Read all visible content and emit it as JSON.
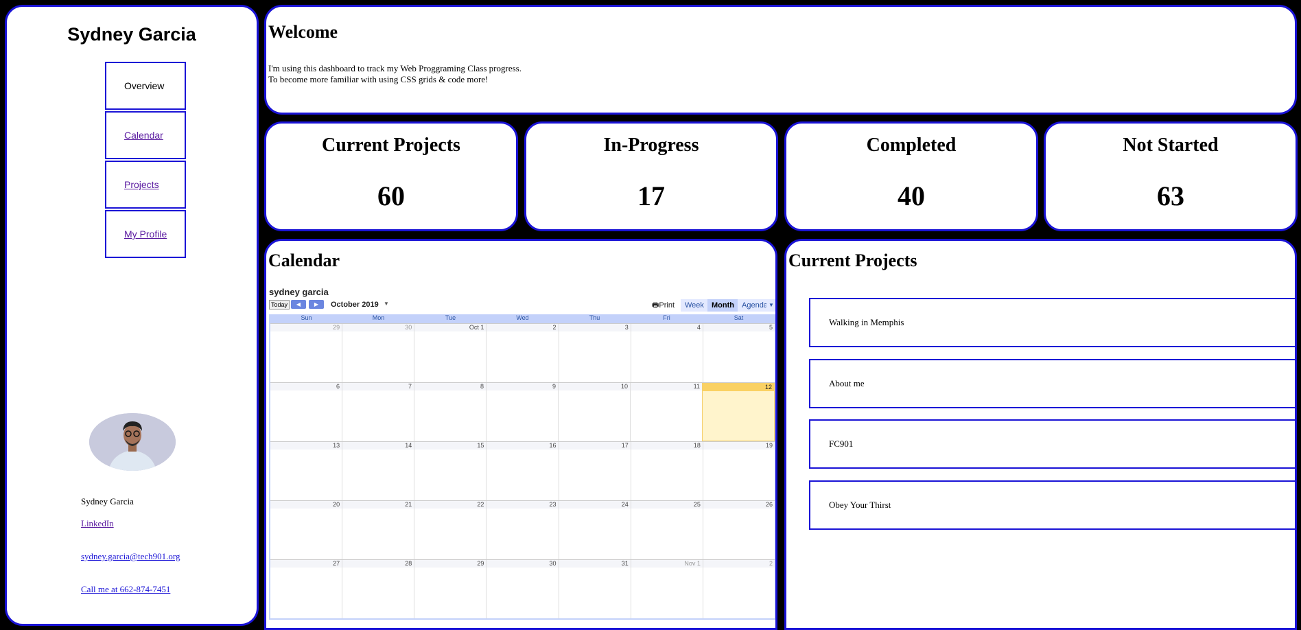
{
  "sidebar": {
    "name": "Sydney Garcia",
    "nav": [
      "Overview",
      "Calendar",
      "Projects",
      "My Profile"
    ],
    "contact": {
      "name": "Sydney Garcia",
      "linkedin": "LinkedIn",
      "email": "sydney.garcia@tech901.org",
      "phone": "Call me at 662-874-7451"
    }
  },
  "welcome": {
    "title": "Welcome",
    "line1": "I'm using this dashboard to track my Web Proggraming Class progress.",
    "line2": "To become more familiar with using CSS grids & code more!"
  },
  "stats": [
    {
      "title": "Current Projects",
      "value": "60"
    },
    {
      "title": "In-Progress",
      "value": "17"
    },
    {
      "title": "Completed",
      "value": "40"
    },
    {
      "title": "Not Started",
      "value": "63"
    }
  ],
  "calendar": {
    "title": "Calendar",
    "owner": "sydney garcia",
    "today_label": "Today",
    "month_label": "October 2019",
    "print_label": "Print",
    "views": [
      "Week",
      "Month",
      "Agenda"
    ],
    "active_view": "Month",
    "weekdays": [
      "Sun",
      "Mon",
      "Tue",
      "Wed",
      "Thu",
      "Fri",
      "Sat"
    ],
    "weeks": [
      [
        "29",
        "30",
        "Oct 1",
        "2",
        "3",
        "4",
        "5"
      ],
      [
        "6",
        "7",
        "8",
        "9",
        "10",
        "11",
        "12"
      ],
      [
        "13",
        "14",
        "15",
        "16",
        "17",
        "18",
        "19"
      ],
      [
        "20",
        "21",
        "22",
        "23",
        "24",
        "25",
        "26"
      ],
      [
        "27",
        "28",
        "29",
        "30",
        "31",
        "Nov 1",
        "2"
      ]
    ],
    "today": "12"
  },
  "projects": {
    "title": "Current Projects",
    "items": [
      "Walking in Memphis",
      "About me",
      "FC901",
      "Obey Your Thirst"
    ]
  },
  "colors": {
    "border": "#1a13d6",
    "background": "#000000",
    "today": "#fad163"
  }
}
